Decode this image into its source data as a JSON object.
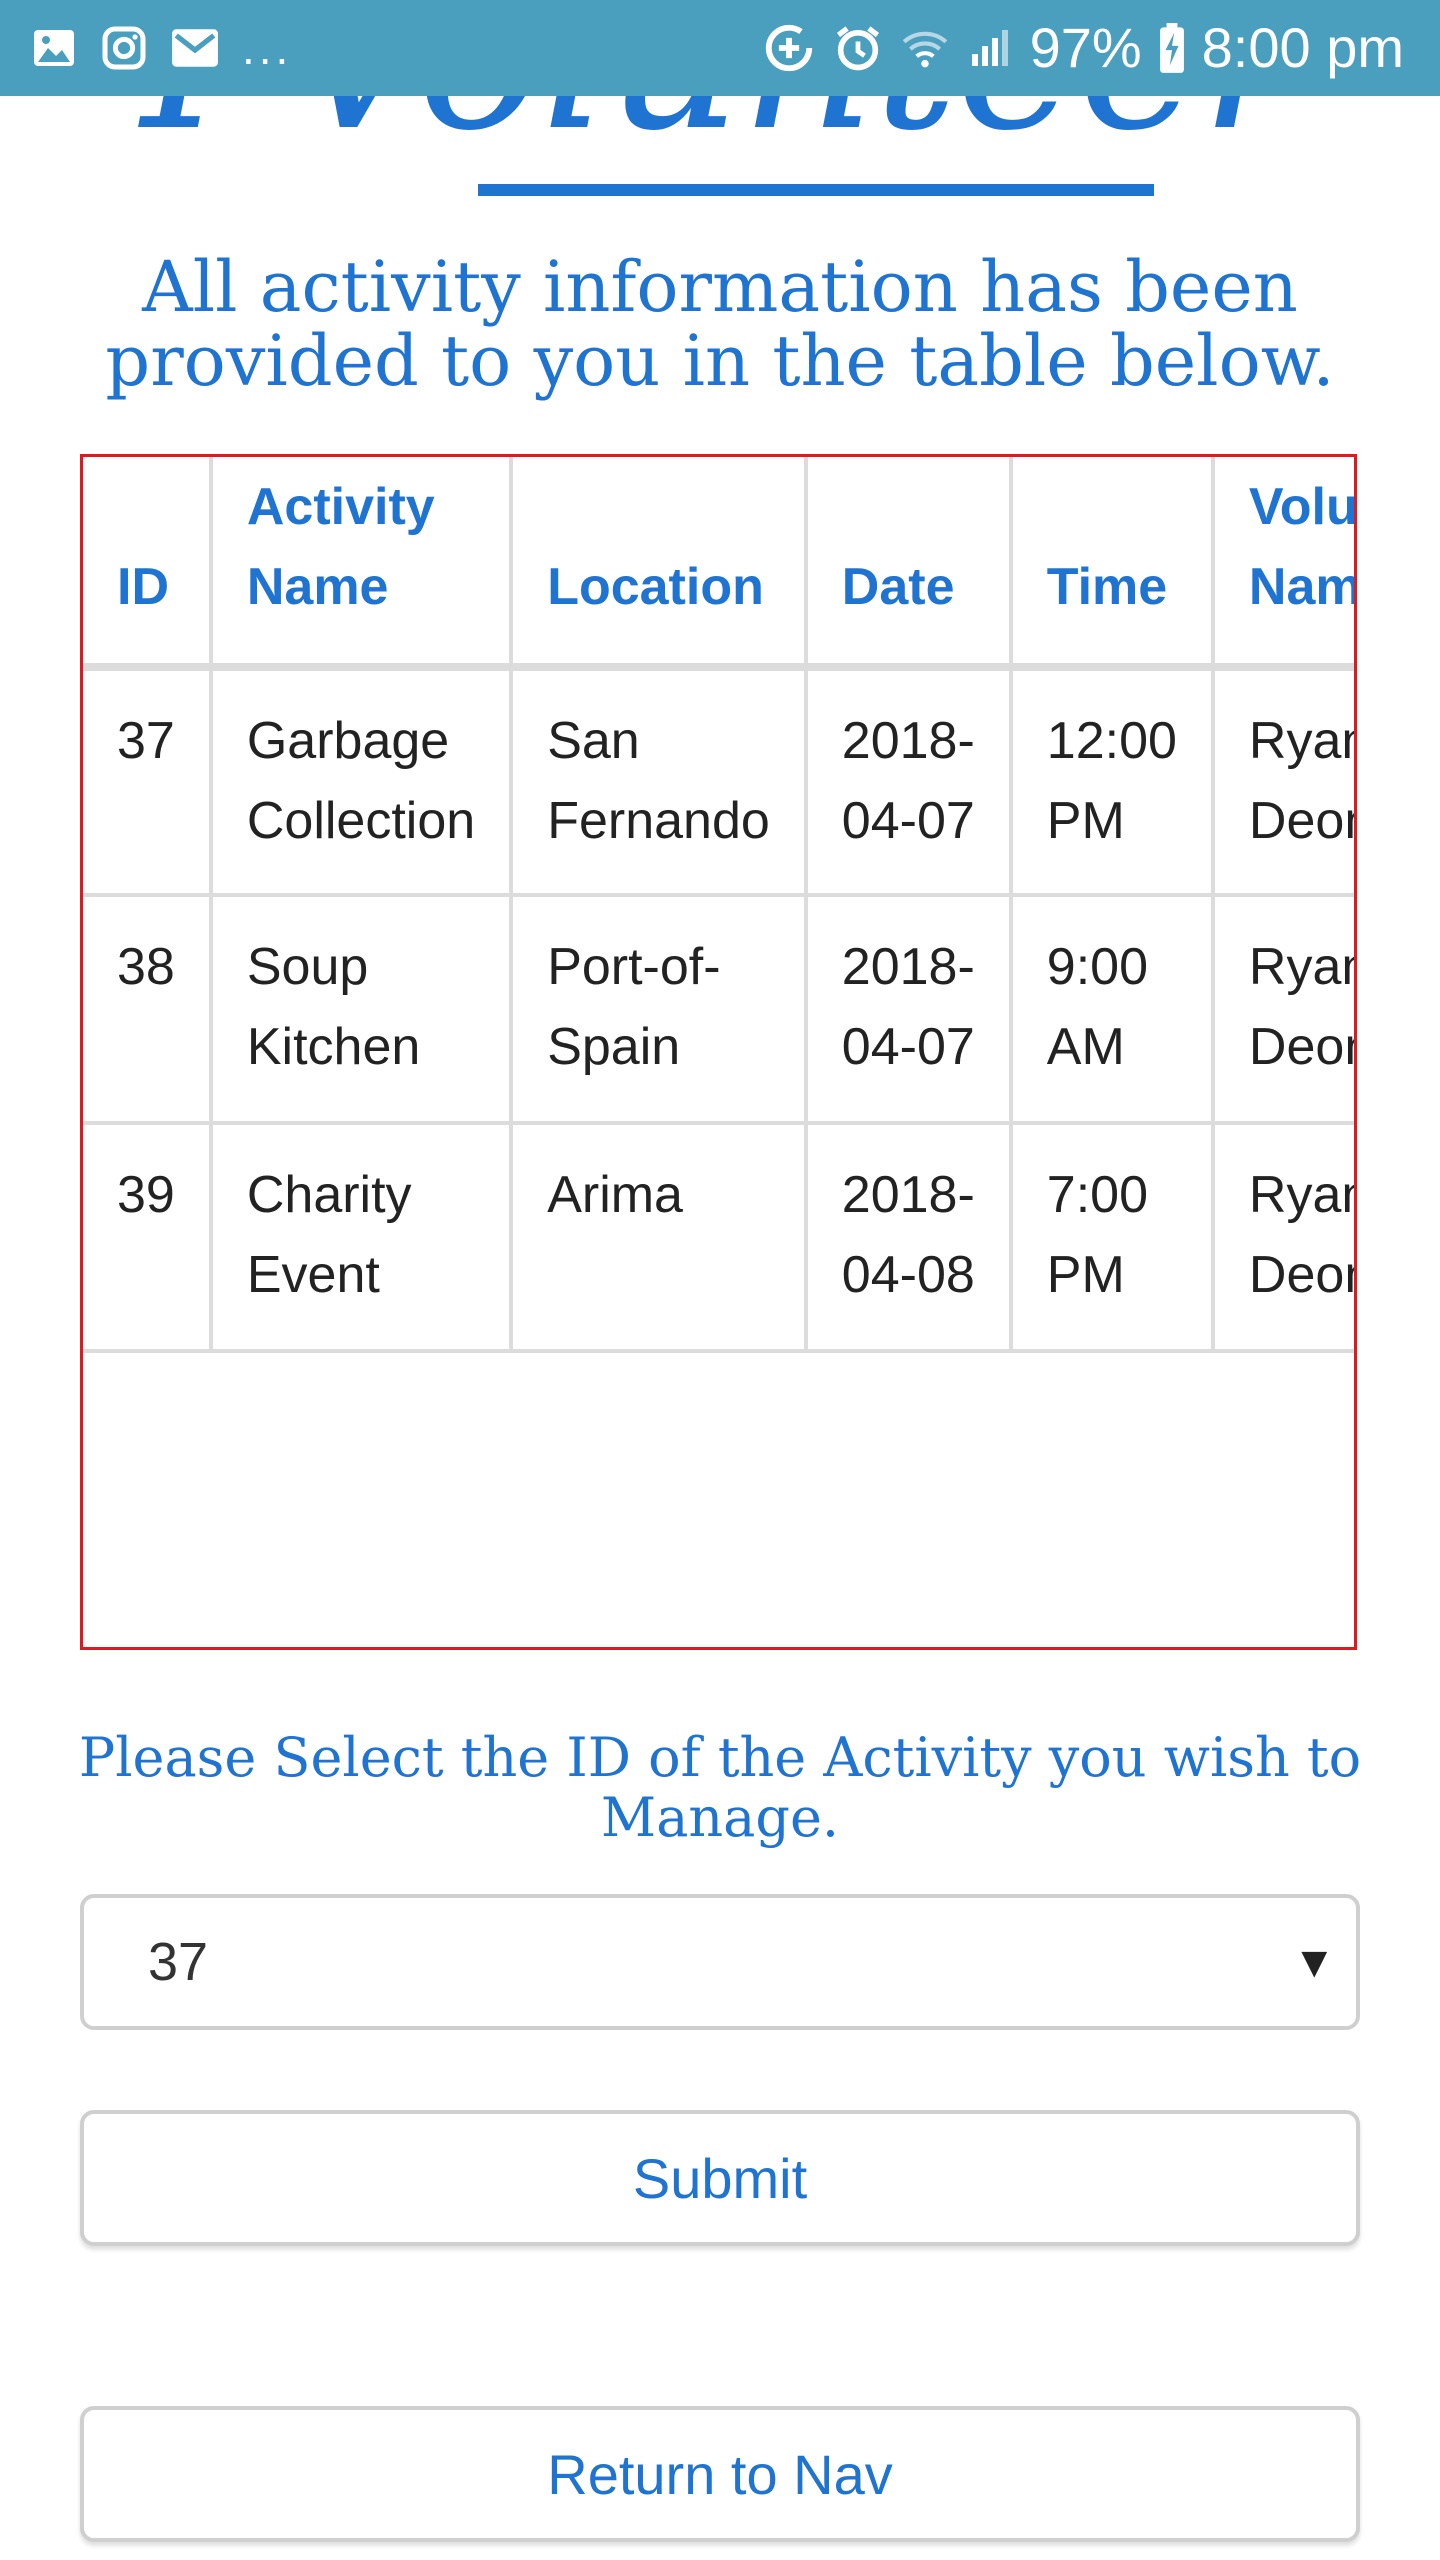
{
  "status_bar": {
    "battery": "97%",
    "time": "8:00 pm",
    "more": "...",
    "left_icons": [
      "image-icon",
      "instagram-icon",
      "gmail-icon"
    ],
    "right_icons": [
      "data-saver-icon",
      "alarm-icon",
      "wifi-icon",
      "signal-icon",
      "battery-charging-icon"
    ]
  },
  "logo": {
    "text": "I Volunteer"
  },
  "intro_text": "All activity information has been provided to you in the table below.",
  "table": {
    "headers": [
      "ID",
      "Activity Name",
      "Location",
      "Date",
      "Time",
      "Volunteer Name"
    ],
    "rows": [
      [
        "37",
        "Garbage Collection",
        "San Fernando",
        "2018-04-07",
        "12:00 PM",
        "Ryan Deonarine"
      ],
      [
        "38",
        "Soup Kitchen",
        "Port-of-Spain",
        "2018-04-07",
        "9:00 AM",
        "Ryan Deonarine"
      ],
      [
        "39",
        "Charity Event",
        "Arima",
        "2018-04-08",
        "7:00 PM",
        "Ryan Deonarine"
      ]
    ]
  },
  "select_prompt": "Please Select the ID of the Activity you wish to Manage.",
  "id_select": {
    "value": "37",
    "arrow": "▼"
  },
  "buttons": {
    "submit": "Submit",
    "return": "Return to Nav"
  },
  "colors": {
    "status_bar": "#4a9fbf",
    "accent": "#1f73d1",
    "table_outline": "#e0191f"
  }
}
